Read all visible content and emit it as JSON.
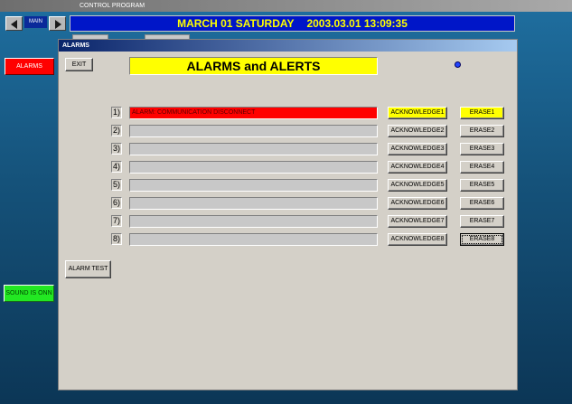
{
  "app": {
    "title": "CONTROL PROGRAM",
    "main_label": "MAIN",
    "day_label": "MARCH 01 SATURDAY",
    "datetime": "2003.03.01 13:09:35"
  },
  "sidebar": {
    "alarms_label": "ALARMS",
    "sound_label": "SOUND IS ONN"
  },
  "dialog": {
    "title": "ALARMS",
    "exit_label": "EXIT",
    "heading": "ALARMS and ALERTS",
    "alarm_test_label": "ALARM TEST",
    "rows": [
      {
        "num": "1)",
        "text": "ALARM: COMMUNICATION DISCONNECT",
        "ack": "ACKNOWLEDGE1",
        "erase": "ERASE1",
        "active": true
      },
      {
        "num": "2)",
        "text": "",
        "ack": "ACKNOWLEDGE2",
        "erase": "ERASE2",
        "active": false
      },
      {
        "num": "3)",
        "text": "",
        "ack": "ACKNOWLEDGE3",
        "erase": "ERASE3",
        "active": false
      },
      {
        "num": "4)",
        "text": "",
        "ack": "ACKNOWLEDGE4",
        "erase": "ERASE4",
        "active": false
      },
      {
        "num": "5)",
        "text": "",
        "ack": "ACKNOWLEDGE5",
        "erase": "ERASE5",
        "active": false
      },
      {
        "num": "6)",
        "text": "",
        "ack": "ACKNOWLEDGE6",
        "erase": "ERASE6",
        "active": false
      },
      {
        "num": "7)",
        "text": "",
        "ack": "ACKNOWLEDGE7",
        "erase": "ERASE7",
        "active": false
      },
      {
        "num": "8)",
        "text": "",
        "ack": "ACKNOWLEDGE8",
        "erase": "ERASE8",
        "active": false
      }
    ]
  },
  "icons": {
    "back": "left-arrow-icon",
    "forward": "right-arrow-icon",
    "status": "status-indicator-icon"
  },
  "colors": {
    "alarm_red": "#ff0000",
    "highlight_yellow": "#ffff00",
    "sound_green": "#22e822",
    "datebar_blue": "#0016c8",
    "date_text": "#ffff00"
  }
}
